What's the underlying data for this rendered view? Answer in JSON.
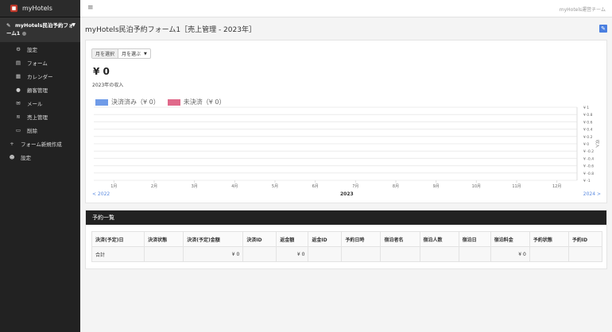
{
  "brand": {
    "name": "myHotels"
  },
  "sidebar": {
    "form_title": "myHotels民泊予約フォーム1",
    "form_dot": "●",
    "items": [
      {
        "icon": "gear-icon",
        "label": "設定",
        "level": "sub"
      },
      {
        "icon": "form-icon",
        "label": "フォーム",
        "level": "sub"
      },
      {
        "icon": "calendar-icon",
        "label": "カレンダー",
        "level": "sub"
      },
      {
        "icon": "customer-icon",
        "label": "顧客管理",
        "level": "sub"
      },
      {
        "icon": "mail-icon",
        "label": "メール",
        "level": "sub"
      },
      {
        "icon": "chart-icon",
        "label": "売上管理",
        "level": "sub"
      },
      {
        "icon": "trash-icon",
        "label": "削除",
        "level": "sub"
      },
      {
        "icon": "plus-icon",
        "label": "フォーム新規作成",
        "level": "top"
      },
      {
        "icon": "users-gear-icon",
        "label": "設定",
        "level": "top"
      }
    ]
  },
  "topbar": {
    "team": "myHotels運営チーム"
  },
  "page": {
    "title": "myHotels民泊予約フォーム1［売上管理 - 2023年］"
  },
  "revenue": {
    "month_label": "月を選択",
    "month_value": "月を選ぶ",
    "total": "¥ 0",
    "total_label": "2023年の収入",
    "prev_year": "< 2022",
    "next_year": "2024 >",
    "year": "2023"
  },
  "chart_data": {
    "type": "bar",
    "categories": [
      "1月",
      "2月",
      "3月",
      "4月",
      "5月",
      "6月",
      "7月",
      "8月",
      "9月",
      "10月",
      "11月",
      "12月"
    ],
    "series": [
      {
        "name": "決済済み（¥ 0）",
        "values": [
          0,
          0,
          0,
          0,
          0,
          0,
          0,
          0,
          0,
          0,
          0,
          0
        ],
        "color": "#6f9be8"
      },
      {
        "name": "未決済（¥ 0）",
        "values": [
          0,
          0,
          0,
          0,
          0,
          0,
          0,
          0,
          0,
          0,
          0,
          0
        ],
        "color": "#e0698a"
      }
    ],
    "y_ticks": [
      "¥ 1",
      "¥ 0.8",
      "¥ 0.6",
      "¥ 0.4",
      "¥ 0.2",
      "¥ 0",
      "¥ -0.2",
      "¥ -0.4",
      "¥ -0.6",
      "¥ -0.8",
      "¥ -1"
    ],
    "ylabel": "収入",
    "ylim": [
      -1,
      1
    ],
    "grid": true,
    "legend": "top-left"
  },
  "reservations": {
    "title": "予約一覧",
    "headers": [
      "決済(予定)日",
      "決済状態",
      "決済(予定)金額",
      "決済ID",
      "返金額",
      "返金ID",
      "予約日時",
      "宿泊者名",
      "宿泊人数",
      "宿泊日",
      "宿泊料金",
      "予約状態",
      "予約ID"
    ],
    "total_row": [
      "合計",
      "",
      "¥ 0",
      "",
      "¥ 0",
      "",
      "",
      "",
      "",
      "",
      "¥ 0",
      "",
      ""
    ]
  },
  "colors": {
    "accent": "#4a7fe0",
    "sidebar": "#222222",
    "panel_head": "#222222"
  }
}
